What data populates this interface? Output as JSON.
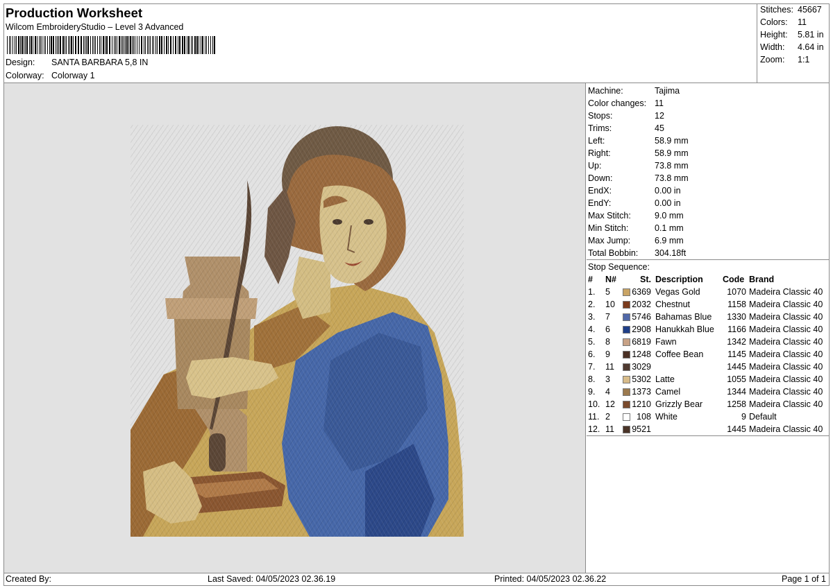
{
  "header": {
    "title": "Production Worksheet",
    "software": "Wilcom EmbroideryStudio – Level 3 Advanced",
    "design_label": "Design:",
    "design_value": "SANTA BARBARA 5,8 IN",
    "colorway_label": "Colorway:",
    "colorway_value": "Colorway 1"
  },
  "summary": [
    {
      "label": "Stitches:",
      "value": "45667"
    },
    {
      "label": "Colors:",
      "value": "11"
    },
    {
      "label": "Height:",
      "value": "5.81 in"
    },
    {
      "label": "Width:",
      "value": "4.64 in"
    },
    {
      "label": "Zoom:",
      "value": "1:1"
    }
  ],
  "specs": [
    {
      "label": "Machine:",
      "value": "Tajima"
    },
    {
      "label": "Color changes:",
      "value": "11"
    },
    {
      "label": "Stops:",
      "value": "12"
    },
    {
      "label": "Trims:",
      "value": "45"
    },
    {
      "label": "Left:",
      "value": "58.9 mm"
    },
    {
      "label": "Right:",
      "value": "58.9 mm"
    },
    {
      "label": "Up:",
      "value": "73.8 mm"
    },
    {
      "label": "Down:",
      "value": "73.8 mm"
    },
    {
      "label": "EndX:",
      "value": "0.00 in"
    },
    {
      "label": "EndY:",
      "value": "0.00 in"
    },
    {
      "label": "Max Stitch:",
      "value": "9.0 mm"
    },
    {
      "label": "Min Stitch:",
      "value": "0.1 mm"
    },
    {
      "label": "Max Jump:",
      "value": "6.9 mm"
    },
    {
      "label": "Total Bobbin:",
      "value": "304.18ft"
    }
  ],
  "stop_sequence": {
    "title": "Stop Sequence:",
    "columns": {
      "num": "#",
      "needle": "N#",
      "st": "St.",
      "desc": "Description",
      "code": "Code",
      "brand": "Brand"
    },
    "rows": [
      {
        "num": "1.",
        "needle": "5",
        "color": "#c9a465",
        "st": "6369",
        "desc": "Vegas Gold",
        "code": "1070",
        "brand": "Madeira Classic 40"
      },
      {
        "num": "2.",
        "needle": "10",
        "color": "#7a3b1d",
        "st": "2032",
        "desc": "Chestnut",
        "code": "1158",
        "brand": "Madeira Classic 40"
      },
      {
        "num": "3.",
        "needle": "7",
        "color": "#5168a8",
        "st": "5746",
        "desc": "Bahamas Blue",
        "code": "1330",
        "brand": "Madeira Classic 40"
      },
      {
        "num": "4.",
        "needle": "6",
        "color": "#1f3f88",
        "st": "2908",
        "desc": "Hanukkah Blue",
        "code": "1166",
        "brand": "Madeira Classic 40"
      },
      {
        "num": "5.",
        "needle": "8",
        "color": "#c8a286",
        "st": "6819",
        "desc": "Fawn",
        "code": "1342",
        "brand": "Madeira Classic 40"
      },
      {
        "num": "6.",
        "needle": "9",
        "color": "#4a3024",
        "st": "1248",
        "desc": "Coffee Bean",
        "code": "1145",
        "brand": "Madeira Classic 40"
      },
      {
        "num": "7.",
        "needle": "11",
        "color": "#4f3a30",
        "st": "3029",
        "desc": "",
        "code": "1445",
        "brand": "Madeira Classic 40"
      },
      {
        "num": "8.",
        "needle": "3",
        "color": "#d8bc8a",
        "st": "5302",
        "desc": "Latte",
        "code": "1055",
        "brand": "Madeira Classic 40"
      },
      {
        "num": "9.",
        "needle": "4",
        "color": "#9c7a4e",
        "st": "1373",
        "desc": "Camel",
        "code": "1344",
        "brand": "Madeira Classic 40"
      },
      {
        "num": "10.",
        "needle": "12",
        "color": "#7a4a2c",
        "st": "1210",
        "desc": "Grizzly Bear",
        "code": "1258",
        "brand": "Madeira Classic 40"
      },
      {
        "num": "11.",
        "needle": "2",
        "color": "#ffffff",
        "st": "108",
        "desc": "White",
        "code": "9",
        "brand": "Default"
      },
      {
        "num": "12.",
        "needle": "11",
        "color": "#4a3428",
        "st": "9521",
        "desc": "",
        "code": "1445",
        "brand": "Madeira Classic 40"
      }
    ]
  },
  "footer": {
    "created_by": "Created By:",
    "last_saved": "Last Saved: 04/05/2023 02.36.19",
    "printed": "Printed: 04/05/2023 02.36.22",
    "page": "Page 1 of 1"
  }
}
